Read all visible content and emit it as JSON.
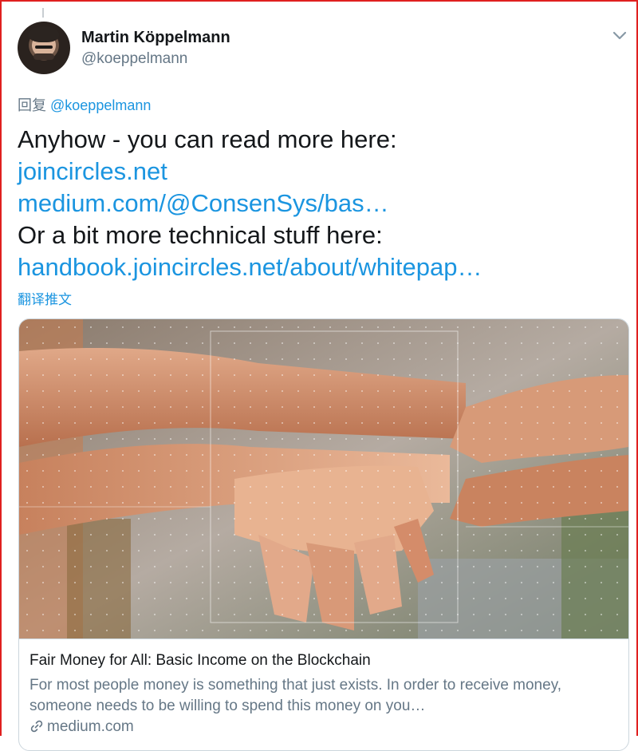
{
  "tweet": {
    "author_name": "Martin Köppelmann",
    "author_handle": "@koeppelmann",
    "reply_prefix": "回复",
    "reply_to": "@koeppelmann",
    "lines": [
      {
        "text": "Anyhow - you can read more here:",
        "link": false
      },
      {
        "text": "joincircles.net",
        "link": true
      },
      {
        "text": "medium.com/@ConsenSys/bas…",
        "link": true
      },
      {
        "text": "Or a bit more technical stuff here:",
        "link": false
      },
      {
        "text": "handbook.joincircles.net/about/whitepap…",
        "link": true
      }
    ],
    "translate_label": "翻译推文"
  },
  "card": {
    "title": "Fair Money for All: Basic Income on the Blockchain",
    "description": "For most people money is something that just exists. In order to receive money, someone needs to be willing to spend this money on you…",
    "domain": "medium.com",
    "image_icon": "stacked-hands-photo"
  },
  "colors": {
    "link": "#1b95e0",
    "secondary": "#657786",
    "text": "#14171a",
    "frame": "#e0201f"
  },
  "icons": {
    "menu": "chevron-down-icon",
    "domain": "link-icon"
  }
}
